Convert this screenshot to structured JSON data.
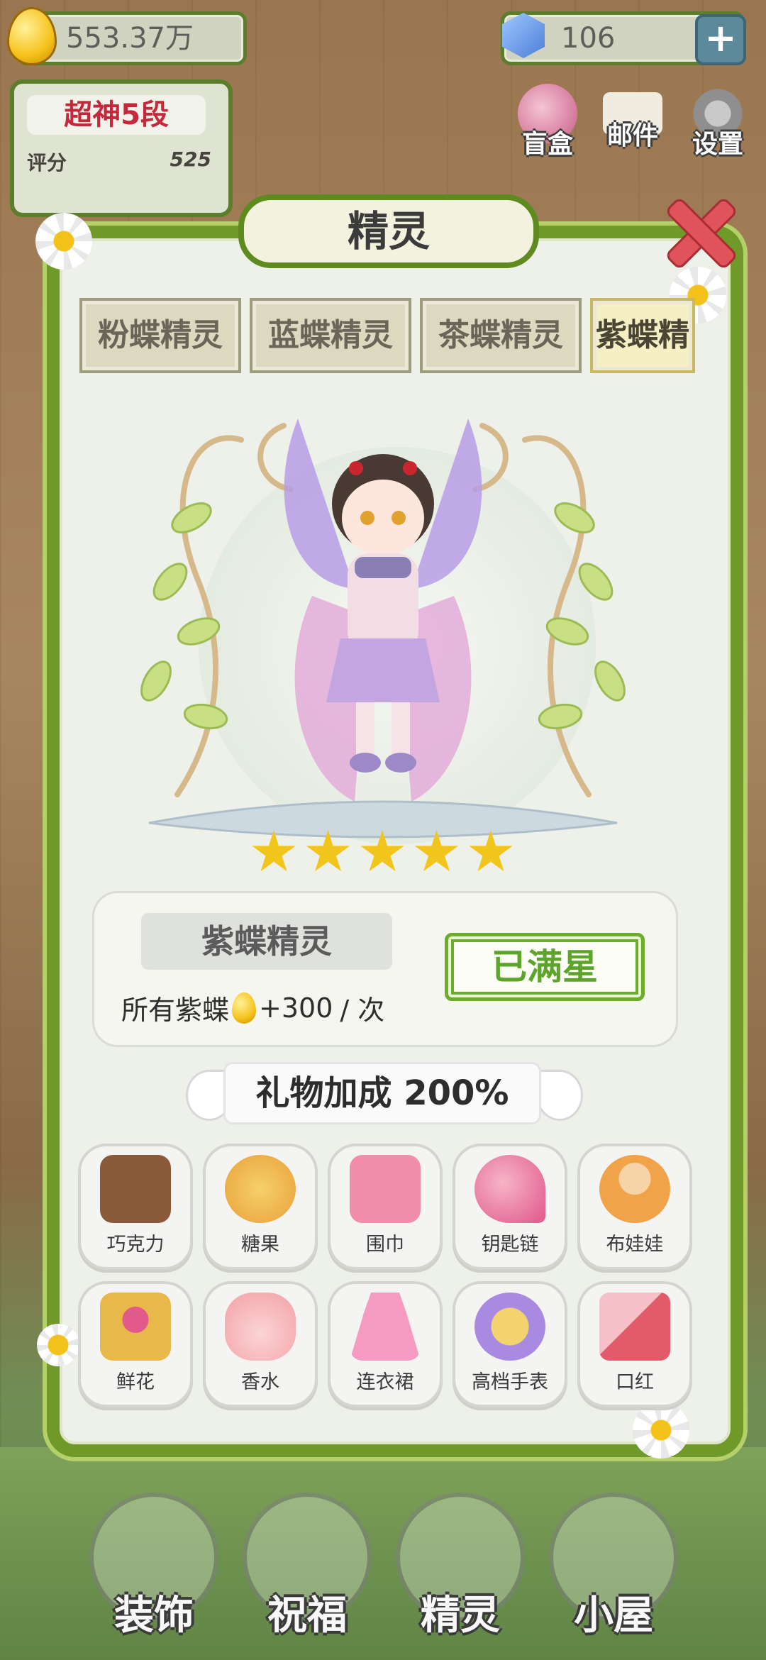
{
  "currency": {
    "coins": "553.37万",
    "gems": "106"
  },
  "rank": {
    "title": "超神5段",
    "score_label": "评分",
    "score_value": "525"
  },
  "top_menu": [
    {
      "label": "盲盒",
      "icon": "gift-box-icon"
    },
    {
      "label": "邮件",
      "icon": "mail-icon"
    },
    {
      "label": "设置",
      "icon": "gear-icon"
    }
  ],
  "panel": {
    "title": "精灵"
  },
  "tabs": [
    "粉蝶精灵",
    "蓝蝶精灵",
    "茶蝶精灵",
    "紫蝶精"
  ],
  "active_tab_index": 3,
  "sprite": {
    "name": "紫蝶精灵",
    "stars": 5,
    "bonus_prefix": "所有紫蝶",
    "bonus_value": "+300",
    "bonus_suffix": "/ 次",
    "action_label": "已满星"
  },
  "gift_bonus": {
    "label": "礼物加成 200%"
  },
  "gifts": [
    {
      "label": "巧克力",
      "icon": "chocolate-icon",
      "color": "#8a5a3a"
    },
    {
      "label": "糖果",
      "icon": "candy-jar-icon",
      "color": "#f0a640"
    },
    {
      "label": "围巾",
      "icon": "scarf-icon",
      "color": "#f28cab"
    },
    {
      "label": "钥匙链",
      "icon": "keychain-icon",
      "color": "#e0578a"
    },
    {
      "label": "布娃娃",
      "icon": "doll-icon",
      "color": "#f1a34a"
    },
    {
      "label": "鲜花",
      "icon": "bouquet-icon",
      "color": "#e8b84a"
    },
    {
      "label": "香水",
      "icon": "perfume-icon",
      "color": "#f3a0a4"
    },
    {
      "label": "连衣裙",
      "icon": "dress-icon",
      "color": "#f59ac0"
    },
    {
      "label": "高档手表",
      "icon": "watch-icon",
      "color": "#a88ae0"
    },
    {
      "label": "口红",
      "icon": "lipstick-icon",
      "color": "#e35a6a"
    }
  ],
  "bottom_nav": [
    {
      "label": "装饰",
      "icon": "plant-pot-icon"
    },
    {
      "label": "祝福",
      "icon": "butterfly-vase-icon"
    },
    {
      "label": "精灵",
      "icon": "fairy-icon"
    },
    {
      "label": "小屋",
      "icon": "house-icon"
    }
  ]
}
